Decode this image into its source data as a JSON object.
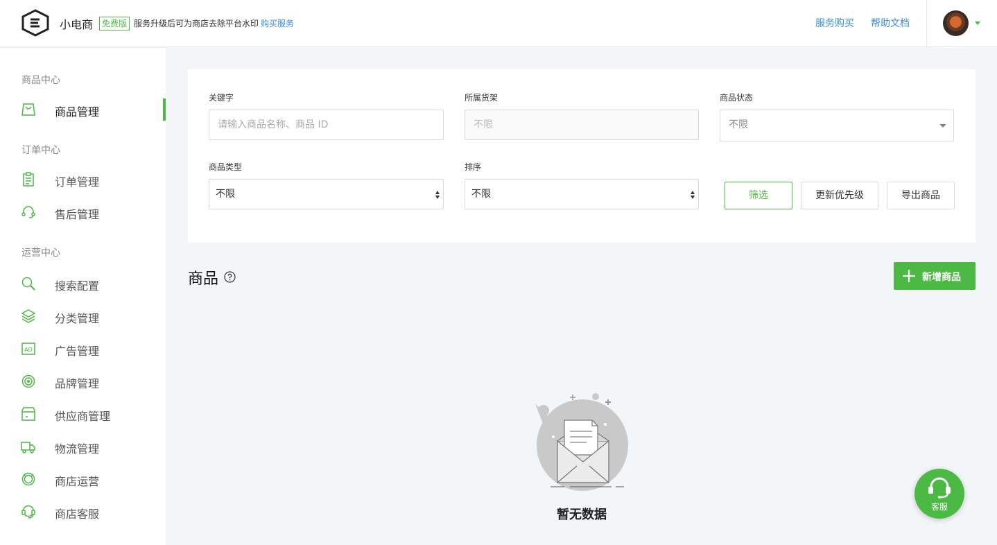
{
  "header": {
    "brand": "小电商",
    "badge": "免费版",
    "notice": "服务升级后可为商店去除平台水印",
    "notice_link": "购买服务",
    "links": [
      "服务购买",
      "帮助文档"
    ],
    "accent_color": "#4cb944",
    "link_color": "#3a8ee6"
  },
  "sidebar": {
    "sections": [
      {
        "title": "商品中心",
        "items": [
          {
            "label": "商品管理",
            "icon": "bag-icon",
            "active": true
          }
        ]
      },
      {
        "title": "订单中心",
        "items": [
          {
            "label": "订单管理",
            "icon": "clipboard-icon"
          },
          {
            "label": "售后管理",
            "icon": "headset-icon"
          }
        ]
      },
      {
        "title": "运营中心",
        "items": [
          {
            "label": "搜索配置",
            "icon": "search-icon"
          },
          {
            "label": "分类管理",
            "icon": "layers-icon"
          },
          {
            "label": "广告管理",
            "icon": "ad-icon"
          },
          {
            "label": "品牌管理",
            "icon": "brand-icon"
          },
          {
            "label": "供应商管理",
            "icon": "supplier-icon"
          },
          {
            "label": "物流管理",
            "icon": "truck-icon"
          },
          {
            "label": "商店运营",
            "icon": "operation-icon"
          },
          {
            "label": "商店客服",
            "icon": "support-icon"
          }
        ]
      }
    ]
  },
  "filter": {
    "keyword_label": "关键字",
    "keyword_placeholder": "请输入商品名称、商品 ID",
    "shelf_label": "所属货架",
    "shelf_value": "不限",
    "status_label": "商品状态",
    "status_value": "不限",
    "type_label": "商品类型",
    "type_value": "不限",
    "sort_label": "排序",
    "sort_value": "不限",
    "filter_button": "筛选",
    "priority_button": "更新优先级",
    "export_button": "导出商品"
  },
  "products": {
    "title": "商品",
    "add_button": "新增商品",
    "empty_text": "暂无数据"
  },
  "service": {
    "label": "客服"
  }
}
